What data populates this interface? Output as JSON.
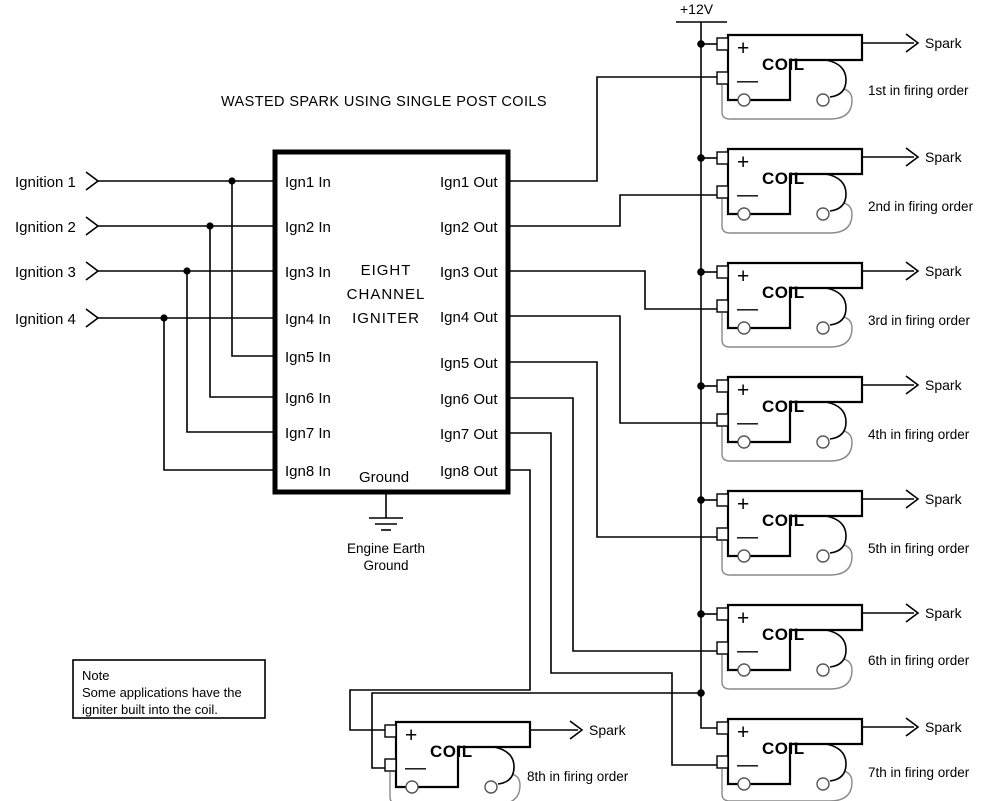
{
  "diagram": {
    "title": "WASTED SPARK USING SINGLE POST COILS",
    "power_rail": {
      "label": "+12V"
    },
    "ground": {
      "pin_label": "Ground",
      "line1": "Engine Earth",
      "line2": "Ground"
    },
    "igniter": {
      "label_line1": "EIGHT",
      "label_line2": "CHANNEL",
      "label_line3": "IGNITER",
      "inputs": [
        "Ign1 In",
        "Ign2 In",
        "Ign3 In",
        "Ign4 In",
        "Ign5 In",
        "Ign6 In",
        "Ign7 In",
        "Ign8 In"
      ],
      "outputs": [
        "Ign1 Out",
        "Ign2 Out",
        "Ign3 Out",
        "Ign4 Out",
        "Ign5 Out",
        "Ign6 Out",
        "Ign7 Out",
        "Ign8 Out"
      ]
    },
    "ignition_inputs": [
      "Ignition 1",
      "Ignition 2",
      "Ignition 3",
      "Ignition 4"
    ],
    "coils": [
      {
        "label": "COIL",
        "plus": "+",
        "minus": "—",
        "spark": "Spark",
        "order": "1st in firing order"
      },
      {
        "label": "COIL",
        "plus": "+",
        "minus": "—",
        "spark": "Spark",
        "order": "2nd in firing order"
      },
      {
        "label": "COIL",
        "plus": "+",
        "minus": "—",
        "spark": "Spark",
        "order": "3rd in firing order"
      },
      {
        "label": "COIL",
        "plus": "+",
        "minus": "—",
        "spark": "Spark",
        "order": "4th in firing order"
      },
      {
        "label": "COIL",
        "plus": "+",
        "minus": "—",
        "spark": "Spark",
        "order": "5th in firing order"
      },
      {
        "label": "COIL",
        "plus": "+",
        "minus": "—",
        "spark": "Spark",
        "order": "6th in firing order"
      },
      {
        "label": "COIL",
        "plus": "+",
        "minus": "—",
        "spark": "Spark",
        "order": "7th in firing order"
      },
      {
        "label": "COIL",
        "plus": "+",
        "minus": "—",
        "spark": "Spark",
        "order": "8th in firing order"
      }
    ],
    "note": {
      "heading": "Note",
      "line1": "Some applications have the",
      "line2": "igniter built into the coil."
    },
    "colors": {
      "wire": "#000000",
      "background": "#ffffff",
      "bracket": "#8a8a8a"
    }
  }
}
